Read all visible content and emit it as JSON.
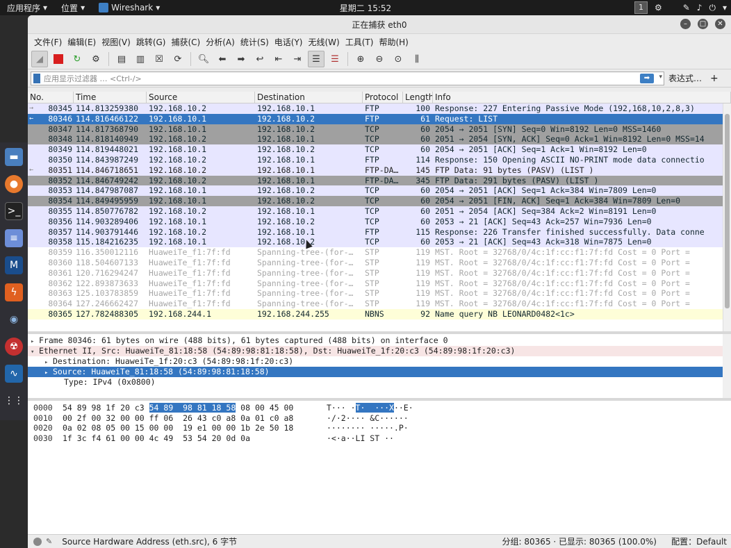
{
  "topbar": {
    "apps": "应用程序",
    "places": "位置",
    "active_app": "Wireshark",
    "clock": "星期二 15:52",
    "workspace": "1"
  },
  "window": {
    "title": "正在捕获 eth0"
  },
  "menu": [
    "文件(F)",
    "编辑(E)",
    "视图(V)",
    "跳转(G)",
    "捕获(C)",
    "分析(A)",
    "统计(S)",
    "电话(Y)",
    "无线(W)",
    "工具(T)",
    "帮助(H)"
  ],
  "filter": {
    "placeholder": "应用显示过滤器 … <Ctrl-/>",
    "expression_label": "表达式…",
    "plus": "+"
  },
  "columns": [
    "No.",
    "Time",
    "Source",
    "Destination",
    "Protocol",
    "Length",
    "Info"
  ],
  "packets": [
    {
      "no": "80345",
      "time": "114.813259380",
      "src": "192.168.10.2",
      "dst": "192.168.10.1",
      "proto": "FTP",
      "len": "100",
      "info": "Response: 227 Entering Passive Mode (192,168,10,2,8,3)",
      "cls": "row-ftp",
      "mark": "→"
    },
    {
      "no": "80346",
      "time": "114.816466122",
      "src": "192.168.10.1",
      "dst": "192.168.10.2",
      "proto": "FTP",
      "len": "61",
      "info": "Request: LIST",
      "cls": "row-sel",
      "mark": "←"
    },
    {
      "no": "80347",
      "time": "114.817368790",
      "src": "192.168.10.1",
      "dst": "192.168.10.2",
      "proto": "TCP",
      "len": "60",
      "info": "2054 → 2051 [SYN] Seq=0 Win=8192 Len=0 MSS=1460",
      "cls": "row-syn",
      "mark": ""
    },
    {
      "no": "80348",
      "time": "114.818140949",
      "src": "192.168.10.2",
      "dst": "192.168.10.1",
      "proto": "TCP",
      "len": "60",
      "info": "2051 → 2054 [SYN, ACK] Seq=0 Ack=1 Win=8192 Len=0 MSS=14",
      "cls": "row-syn",
      "mark": ""
    },
    {
      "no": "80349",
      "time": "114.819448021",
      "src": "192.168.10.1",
      "dst": "192.168.10.2",
      "proto": "TCP",
      "len": "60",
      "info": "2054 → 2051 [ACK] Seq=1 Ack=1 Win=8192 Len=0",
      "cls": "row-tcp",
      "mark": ""
    },
    {
      "no": "80350",
      "time": "114.843987249",
      "src": "192.168.10.2",
      "dst": "192.168.10.1",
      "proto": "FTP",
      "len": "114",
      "info": "Response: 150 Opening ASCII NO-PRINT mode data connectio",
      "cls": "row-ftp",
      "mark": ""
    },
    {
      "no": "80351",
      "time": "114.846718651",
      "src": "192.168.10.2",
      "dst": "192.168.10.1",
      "proto": "FTP-DA…",
      "len": "145",
      "info": "FTP Data: 91 bytes (PASV) (LIST )",
      "cls": "row-data",
      "mark": "←"
    },
    {
      "no": "80352",
      "time": "114.846749242",
      "src": "192.168.10.2",
      "dst": "192.168.10.1",
      "proto": "FTP-DA…",
      "len": "345",
      "info": "FTP Data: 291 bytes (PASV) (LIST )",
      "cls": "row-syn",
      "mark": ""
    },
    {
      "no": "80353",
      "time": "114.847987087",
      "src": "192.168.10.1",
      "dst": "192.168.10.2",
      "proto": "TCP",
      "len": "60",
      "info": "2054 → 2051 [ACK] Seq=1 Ack=384 Win=7809 Len=0",
      "cls": "row-tcp",
      "mark": ""
    },
    {
      "no": "80354",
      "time": "114.849495959",
      "src": "192.168.10.1",
      "dst": "192.168.10.2",
      "proto": "TCP",
      "len": "60",
      "info": "2054 → 2051 [FIN, ACK] Seq=1 Ack=384 Win=7809 Len=0",
      "cls": "row-syn",
      "mark": ""
    },
    {
      "no": "80355",
      "time": "114.850776782",
      "src": "192.168.10.2",
      "dst": "192.168.10.1",
      "proto": "TCP",
      "len": "60",
      "info": "2051 → 2054 [ACK] Seq=384 Ack=2 Win=8191 Len=0",
      "cls": "row-tcp",
      "mark": ""
    },
    {
      "no": "80356",
      "time": "114.903289406",
      "src": "192.168.10.1",
      "dst": "192.168.10.2",
      "proto": "TCP",
      "len": "60",
      "info": "2053 → 21 [ACK] Seq=43 Ack=257 Win=7936 Len=0",
      "cls": "row-tcp",
      "mark": ""
    },
    {
      "no": "80357",
      "time": "114.903791446",
      "src": "192.168.10.2",
      "dst": "192.168.10.1",
      "proto": "FTP",
      "len": "115",
      "info": "Response: 226 Transfer finished successfully. Data conne",
      "cls": "row-ftp",
      "mark": ""
    },
    {
      "no": "80358",
      "time": "115.184216235",
      "src": "192.168.10.1",
      "dst": "192.168.10.2",
      "proto": "TCP",
      "len": "60",
      "info": "2053 → 21 [ACK] Seq=43 Ack=318 Win=7875 Len=0",
      "cls": "row-tcp",
      "mark": ""
    },
    {
      "no": "80359",
      "time": "116.350012116",
      "src": "HuaweiTe_f1:7f:fd",
      "dst": "Spanning-tree-(for-…",
      "proto": "STP",
      "len": "119",
      "info": "MST. Root = 32768/0/4c:1f:cc:f1:7f:fd  Cost = 0  Port =",
      "cls": "row-stp",
      "mark": ""
    },
    {
      "no": "80360",
      "time": "118.504607133",
      "src": "HuaweiTe_f1:7f:fd",
      "dst": "Spanning-tree-(for-…",
      "proto": "STP",
      "len": "119",
      "info": "MST. Root = 32768/0/4c:1f:cc:f1:7f:fd  Cost = 0  Port =",
      "cls": "row-stp",
      "mark": ""
    },
    {
      "no": "80361",
      "time": "120.716294247",
      "src": "HuaweiTe_f1:7f:fd",
      "dst": "Spanning-tree-(for-…",
      "proto": "STP",
      "len": "119",
      "info": "MST. Root = 32768/0/4c:1f:cc:f1:7f:fd  Cost = 0  Port =",
      "cls": "row-stp",
      "mark": ""
    },
    {
      "no": "80362",
      "time": "122.893873633",
      "src": "HuaweiTe_f1:7f:fd",
      "dst": "Spanning-tree-(for-…",
      "proto": "STP",
      "len": "119",
      "info": "MST. Root = 32768/0/4c:1f:cc:f1:7f:fd  Cost = 0  Port =",
      "cls": "row-stp",
      "mark": ""
    },
    {
      "no": "80363",
      "time": "125.103783859",
      "src": "HuaweiTe_f1:7f:fd",
      "dst": "Spanning-tree-(for-…",
      "proto": "STP",
      "len": "119",
      "info": "MST. Root = 32768/0/4c:1f:cc:f1:7f:fd  Cost = 0  Port =",
      "cls": "row-stp",
      "mark": ""
    },
    {
      "no": "80364",
      "time": "127.246662427",
      "src": "HuaweiTe_f1:7f:fd",
      "dst": "Spanning-tree-(for-…",
      "proto": "STP",
      "len": "119",
      "info": "MST. Root = 32768/0/4c:1f:cc:f1:7f:fd  Cost = 0  Port =",
      "cls": "row-stp",
      "mark": ""
    },
    {
      "no": "80365",
      "time": "127.782488305",
      "src": "192.168.244.1",
      "dst": "192.168.244.255",
      "proto": "NBNS",
      "len": "92",
      "info": "Name query NB LEONARD0482<1c>",
      "cls": "row-nbns",
      "mark": ""
    }
  ],
  "details": [
    {
      "text": "Frame 80346: 61 bytes on wire (488 bits), 61 bytes captured (488 bits) on interface 0",
      "cls": "",
      "tri": "▸",
      "ind": ""
    },
    {
      "text": "Ethernet II, Src: HuaweiTe_81:18:58 (54:89:98:81:18:58), Dst: HuaweiTe_1f:20:c3 (54:89:98:1f:20:c3)",
      "cls": "eth",
      "tri": "▾",
      "ind": ""
    },
    {
      "text": "Destination: HuaweiTe_1f:20:c3 (54:89:98:1f:20:c3)",
      "cls": "",
      "tri": "▸",
      "ind": "ind1"
    },
    {
      "text": "Source: HuaweiTe_81:18:58 (54:89:98:81:18:58)",
      "cls": "sel",
      "tri": "▸",
      "ind": "ind1"
    },
    {
      "text": "Type: IPv4 (0x0800)",
      "cls": "",
      "tri": "",
      "ind": "ind2"
    }
  ],
  "bytes": [
    {
      "off": "0000",
      "hex_a": "54 89 98 1f 20 c3 ",
      "hex_hl": "54 89  98 81 18 58",
      "hex_b": " 08 00 45 00",
      "asc_a": "T··· ·",
      "asc_hl": "T·  ···X",
      "asc_b": "··E·"
    },
    {
      "off": "0010",
      "hex_a": "00 2f 00 32 00 00 ff 06  26 43 c0 a8 0a 01 c0 a8",
      "hex_hl": "",
      "hex_b": "",
      "asc_a": "·/·2···· &C······",
      "asc_hl": "",
      "asc_b": ""
    },
    {
      "off": "0020",
      "hex_a": "0a 02 08 05 00 15 00 00  19 e1 00 00 1b 2e 50 18",
      "hex_hl": "",
      "hex_b": "",
      "asc_a": "········ ·····.P·",
      "asc_hl": "",
      "asc_b": ""
    },
    {
      "off": "0030",
      "hex_a": "1f 3c f4 61 00 00 4c 49  53 54 20 0d 0a",
      "hex_hl": "",
      "hex_b": "",
      "asc_a": "·<·a··LI ST ··",
      "asc_hl": "",
      "asc_b": ""
    }
  ],
  "status": {
    "field": "Source Hardware Address (eth.src), 6 字节",
    "counts": "分组: 80365 · 已显示: 80365 (100.0%)",
    "profile": "配置：Default"
  }
}
